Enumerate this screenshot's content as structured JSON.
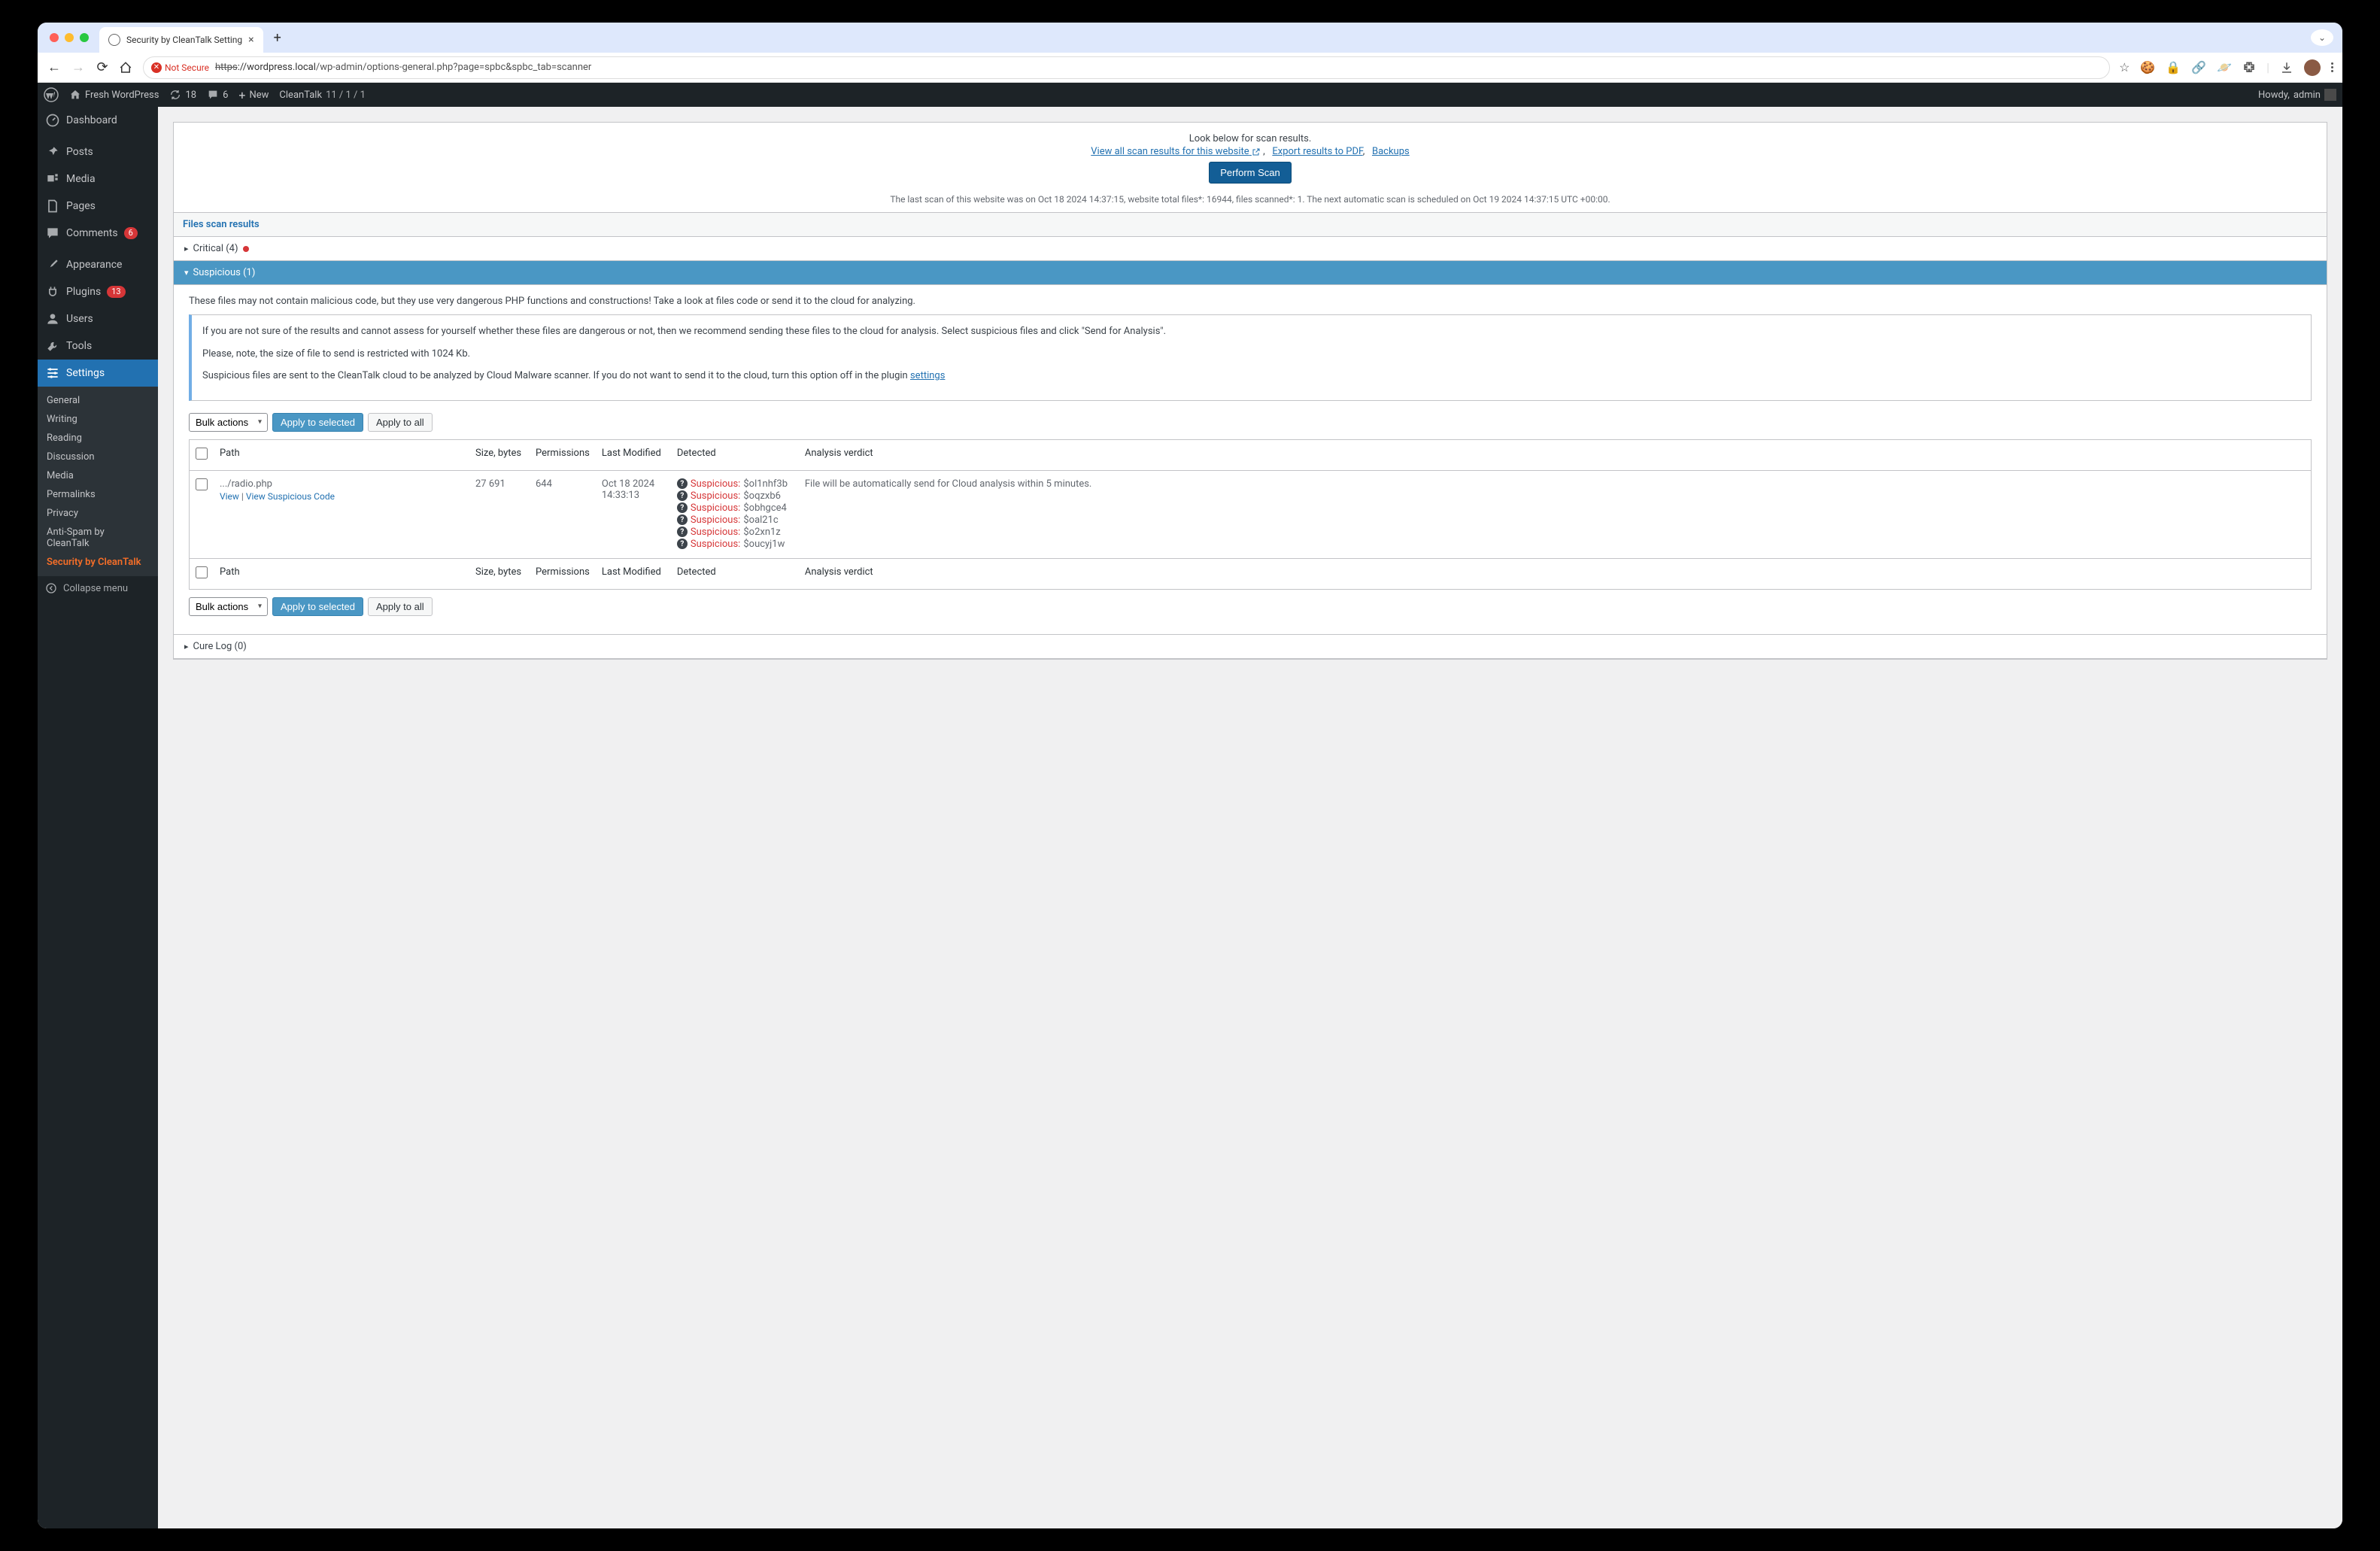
{
  "browser": {
    "tab_title": "Security by CleanTalk Setting",
    "not_secure": "Not Secure",
    "url_protocol": "https",
    "url_domain": "://wordpress.local",
    "url_path": "/wp-admin/options-general.php?page=spbc&spbc_tab=scanner"
  },
  "adminbar": {
    "site_name": "Fresh WordPress",
    "updates": "18",
    "comments": "6",
    "new": "New",
    "cleantalk": "CleanTalk",
    "cleantalk_counts": "11 / 1 / 1",
    "howdy_prefix": "Howdy,",
    "howdy_user": "admin"
  },
  "sidebar": {
    "dashboard": "Dashboard",
    "posts": "Posts",
    "media": "Media",
    "pages": "Pages",
    "comments": "Comments",
    "comments_badge": "6",
    "appearance": "Appearance",
    "plugins": "Plugins",
    "plugins_badge": "13",
    "users": "Users",
    "tools": "Tools",
    "settings": "Settings",
    "submenu": {
      "general": "General",
      "writing": "Writing",
      "reading": "Reading",
      "discussion": "Discussion",
      "media": "Media",
      "permalinks": "Permalinks",
      "privacy": "Privacy",
      "antispam": "Anti-Spam by CleanTalk",
      "security": "Security by CleanTalk"
    },
    "collapse": "Collapse menu"
  },
  "content": {
    "look_below": "Look below for scan results.",
    "view_all_link": "View all scan results for this website",
    "export_link": "Export results to PDF",
    "backups_link": "Backups",
    "perform_scan": "Perform Scan",
    "scan_status": "The last scan of this website was on Oct 18 2024 14:37:15, website total files*: 16944, files scanned*: 1. The next automatic scan is scheduled on Oct 19 2024 14:37:15 UTC +00:00.",
    "files_scan_results": "Files scan results",
    "critical_label": "Critical (4)",
    "suspicious_label": "Suspicious (1)",
    "suspicious_desc": "These files may not contain malicious code, but they use very dangerous PHP functions and constructions! Take a look at files code or send it to the cloud for analyzing.",
    "info_p1": "If you are not sure of the results and cannot assess for yourself whether these files are dangerous or not, then we recommend sending these files to the cloud for analysis. Select suspicious files and click \"Send for Analysis\".",
    "info_p2": "Please, note, the size of file to send is restricted with 1024 Kb.",
    "info_p3_a": "Suspicious files are sent to the CleanTalk cloud to be analyzed by Cloud Malware scanner. If you do not want to send it to the cloud, turn this option off in the plugin ",
    "info_p3_link": "settings",
    "bulk_actions": "Bulk actions",
    "apply_selected": "Apply to selected",
    "apply_all": "Apply to all",
    "cols": {
      "path": "Path",
      "size": "Size, bytes",
      "perms": "Permissions",
      "modified": "Last Modified",
      "detected": "Detected",
      "verdict": "Analysis verdict"
    },
    "row": {
      "path": ".../radio.php",
      "view": "View",
      "view_susp": "View Suspicious Code",
      "size": "27 691",
      "perms": "644",
      "modified_date": "Oct 18 2024",
      "modified_time": "14:33:13",
      "susp_label": "Suspicious:",
      "detected": [
        "$ol1nhf3b",
        "$oqzxb6",
        "$obhgce4",
        "$oal21c",
        "$o2xn1z",
        "$oucyj1w"
      ],
      "verdict": "File will be automatically send for Cloud analysis within 5 minutes."
    },
    "cure_log": "Cure Log (0)"
  }
}
